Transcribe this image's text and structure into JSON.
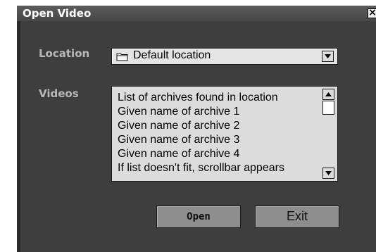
{
  "window": {
    "title": "Open Video",
    "close_glyph": "×"
  },
  "location": {
    "label": "Location",
    "icon": "folder-icon",
    "selected": "Default location"
  },
  "videos": {
    "label": "Videos",
    "items": [
      "List of archives found in location",
      "Given name of archive 1",
      "Given name of archive 2",
      "Given name of archive 3",
      "Given name of archive 4",
      "If list doesn't fit, scrollbar appears"
    ]
  },
  "buttons": {
    "open_label": "Open",
    "exit_label": "Exit"
  }
}
